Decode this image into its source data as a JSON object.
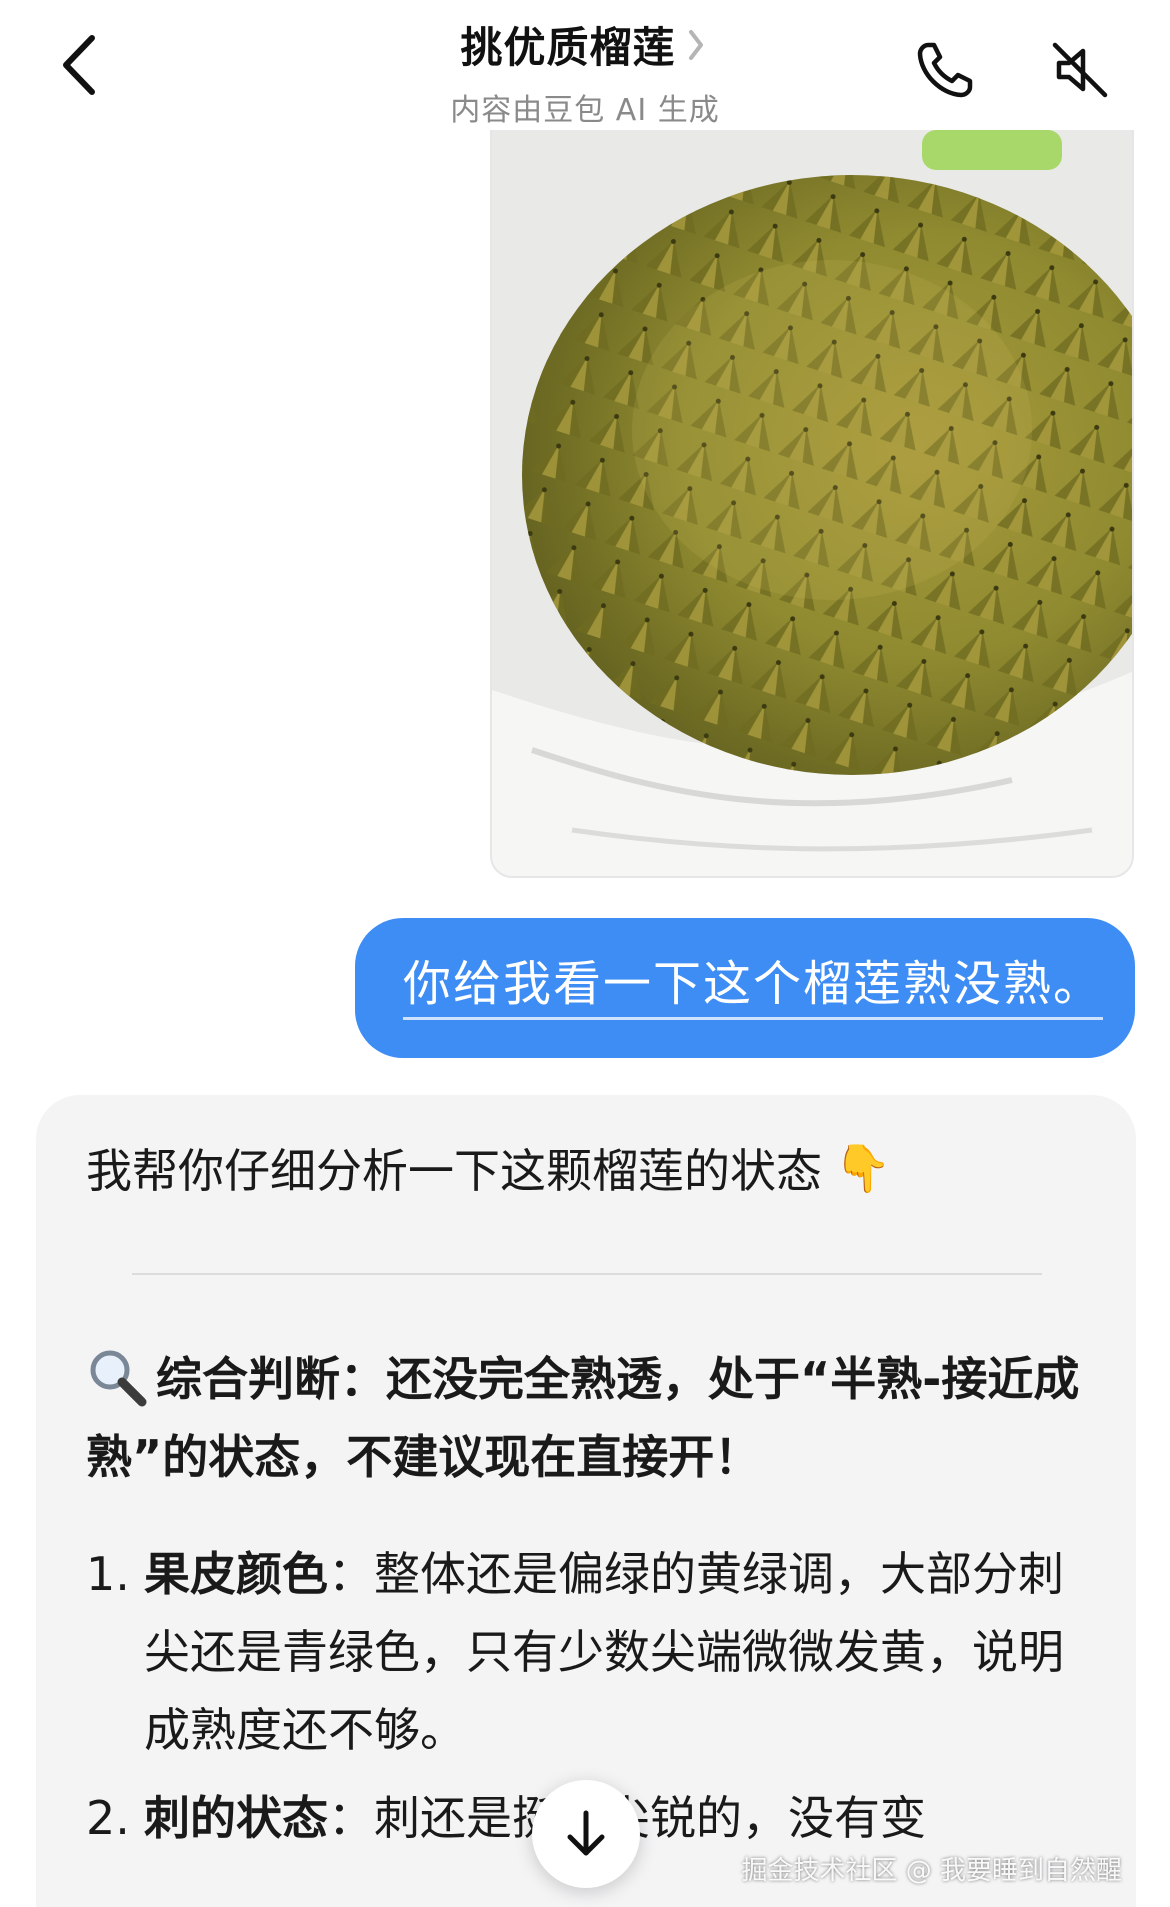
{
  "header": {
    "title": "挑优质榴莲",
    "subtitle": "内容由豆包 AI 生成",
    "back_icon": "chevron-left-icon",
    "title_chevron_icon": "chevron-right-icon",
    "call_icon": "phone-icon",
    "mute_icon": "speaker-muted-icon"
  },
  "photo": {
    "subject": "durian-photo"
  },
  "user_message": {
    "text": "你给我看一下这个榴莲熟没熟。"
  },
  "ai_message": {
    "intro": "我帮你仔细分析一下这颗榴莲的状态",
    "intro_emoji": "👇",
    "summary_emoji": "magnifier-icon",
    "summary": "综合判断：还没完全熟透，处于“半熟-接近成熟”的状态，不建议现在直接开！",
    "items": [
      {
        "num": "1.",
        "label": "果皮颜色",
        "sep": "：",
        "text": "整体还是偏绿的黄绿调，大部分刺尖还是青绿色，只有少数尖端微微发黄，说明成熟度还不够。"
      },
      {
        "num": "2.",
        "label": "刺的状态",
        "sep": "：",
        "text": "刺还是挺、尖锐的，没有变"
      }
    ]
  },
  "scroll_button": {
    "icon": "arrow-down-icon"
  },
  "watermark": "掘金技术社区 @ 我要睡到自然醒",
  "colors": {
    "accent": "#3d8df5",
    "card_bg": "#f4f4f5",
    "subtitle": "#8a8a8a"
  }
}
